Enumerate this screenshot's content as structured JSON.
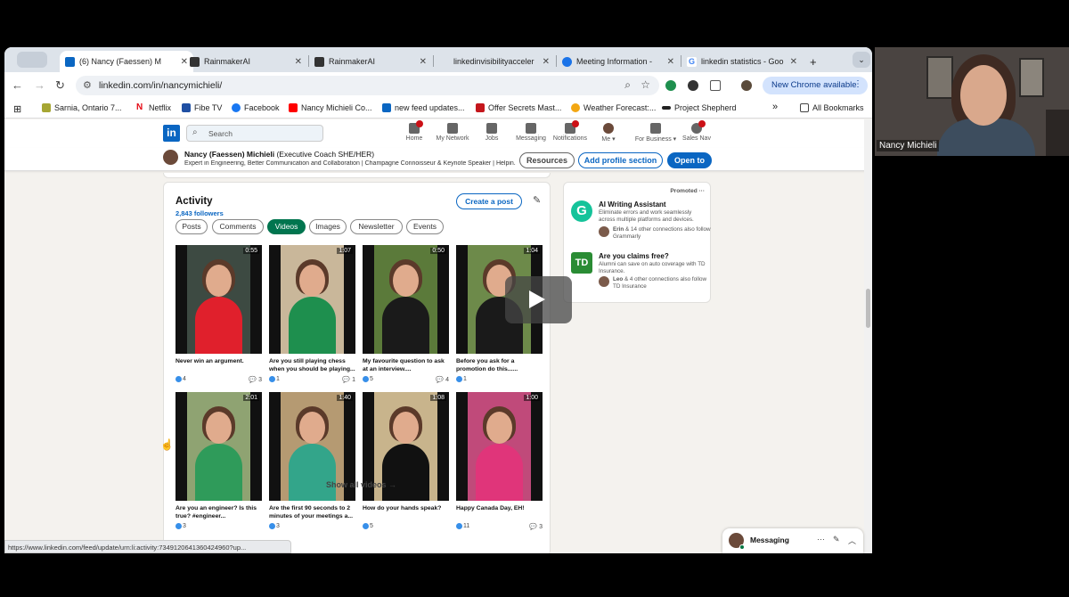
{
  "browser": {
    "tabs": [
      {
        "label": "(6) Nancy (Faessen) M",
        "color": "#0a66c2",
        "active": true
      },
      {
        "label": "RainmakerAI",
        "color": "#333333"
      },
      {
        "label": "RainmakerAI",
        "color": "#333333"
      },
      {
        "label": "linkedinvisibilityacceler",
        "color": "#999999"
      },
      {
        "label": "Meeting Information - ",
        "color": "#1a73e8"
      },
      {
        "label": "linkedin statistics - Goo",
        "color": "#4285f4"
      }
    ],
    "new_tab": "+",
    "url": "linkedin.com/in/nancymichieli/",
    "new_chrome_label": "New Chrome available",
    "bookmarks": [
      {
        "label": "Sarnia, Ontario 7...",
        "color": "#a6a633"
      },
      {
        "label": "Netflix",
        "color": "#e50914"
      },
      {
        "label": "Fibe TV",
        "color": "#1f4fa3"
      },
      {
        "label": "Facebook",
        "color": "#1877f2"
      },
      {
        "label": "Nancy Michieli Co...",
        "color": "#ff0000"
      },
      {
        "label": "new feed updates...",
        "color": "#0a66c2"
      },
      {
        "label": "Offer Secrets Mast...",
        "color": "#c4161c"
      },
      {
        "label": "Weather Forecast:...",
        "color": "#f3a712"
      },
      {
        "label": "Project Shepherd",
        "color": "#222222"
      }
    ],
    "bookmarks_more": "»",
    "all_bookmarks": "All Bookmarks",
    "status_url": "https://www.linkedin.com/feed/update/urn:li:activity:7349120641360424960?up..."
  },
  "linkedin": {
    "logo": "in",
    "search_placeholder": "Search",
    "nav": [
      {
        "label": "Home",
        "badge": true
      },
      {
        "label": "My Network",
        "badge": false
      },
      {
        "label": "Jobs",
        "badge": false
      },
      {
        "label": "Messaging",
        "badge": false
      },
      {
        "label": "Notifications",
        "badge": true
      },
      {
        "label": "Me ▾",
        "badge": false
      },
      {
        "label": "For Business ▾",
        "badge": false
      },
      {
        "label": "Sales Nav",
        "badge": true
      }
    ],
    "profile": {
      "name": "Nancy (Faessen) Michieli",
      "pronouns": "(Executive Coach SHE/HER)",
      "headline": "Expert in Engineering, Better Communication and Collaboration | Champagne Connoisseur & Keynote Speaker | Helpin...",
      "resources_button": "Resources",
      "add_section_button": "Add profile section",
      "open_to_button": "Open to"
    },
    "activity": {
      "title": "Activity",
      "followers": "2,843 followers",
      "create_post": "Create a post",
      "filters": [
        "Posts",
        "Comments",
        "Videos",
        "Images",
        "Newsletter",
        "Events"
      ],
      "active_filter": "Videos",
      "videos": [
        {
          "duration": "0:55",
          "caption": "Never win an argument.",
          "reactions": "4",
          "comments": "3",
          "outfit": "#e0202c",
          "bg": "#3d4a42"
        },
        {
          "duration": "1:07",
          "caption": "Are you still playing chess when you should be playing...",
          "reactions": "1",
          "comments": "1",
          "outfit": "#1e8f4e",
          "bg": "#c9b79a"
        },
        {
          "duration": "0:50",
          "caption": "My favourite question to ask at an interview....",
          "reactions": "5",
          "comments": "4",
          "outfit": "#1a1a1a",
          "bg": "#5b7a3a"
        },
        {
          "duration": "1:04",
          "caption": "Before you ask for a promotion do this......",
          "reactions": "1",
          "comments": "",
          "outfit": "#1a1a1a",
          "bg": "#6d8a4a"
        },
        {
          "duration": "2:01",
          "caption": "Are you an engineer? Is this true? #engineer...",
          "reactions": "3",
          "comments": "",
          "outfit": "#2f9b5a",
          "bg": "#8fa372"
        },
        {
          "duration": "1:40",
          "caption": "Are the first 90 seconds to 2 minutes of your meetings a...",
          "reactions": "3",
          "comments": "",
          "outfit": "#33a58a",
          "bg": "#b59a72"
        },
        {
          "duration": "1:08",
          "caption": "How do your hands speak?",
          "reactions": "5",
          "comments": "",
          "outfit": "#111111",
          "bg": "#c8b48c"
        },
        {
          "duration": "1:00",
          "caption": "Happy Canada Day, EH!",
          "reactions": "11",
          "comments": "3",
          "outfit": "#e0357a",
          "bg": "#c04a7a"
        }
      ],
      "show_all": "Show all videos →"
    },
    "promoted": {
      "label": "Promoted",
      "ads": [
        {
          "title": "AI Writing Assistant",
          "description": "Eliminate errors and work seamlessly across multiple platforms and devices.",
          "connections_name": "Erin",
          "connections_text": "& 14 other connections also follow Grammarly",
          "logo_text": "G",
          "logo_color": "#15c39a"
        },
        {
          "title": "Are you claims free?",
          "description": "Alumni can save on auto coverage with TD Insurance.",
          "connections_name": "Leo",
          "connections_text": "& 4 other connections also follow TD Insurance",
          "logo_text": "TD",
          "logo_color": "#2a8c34"
        }
      ]
    },
    "messaging_label": "Messaging"
  },
  "webcam": {
    "name": "Nancy Michieli"
  }
}
